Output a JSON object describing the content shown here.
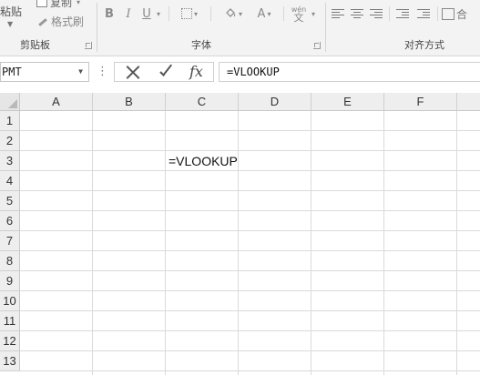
{
  "ribbon": {
    "clipboard": {
      "paste_label": "粘贴",
      "copy_label": "复制",
      "format_painter_label": "格式刷",
      "group_label": "剪贴板"
    },
    "font": {
      "bold": "B",
      "italic": "I",
      "underline": "U",
      "font_color": "A",
      "phonetic_top": "wén",
      "phonetic_bottom": "文",
      "group_label": "字体"
    },
    "alignment": {
      "group_label": "对齐方式",
      "merge_label": "合"
    }
  },
  "formula_bar": {
    "name_box": "PMT",
    "formula": "=VLOOKUP",
    "fx": "fx"
  },
  "sheet": {
    "columns": [
      "A",
      "B",
      "C",
      "D",
      "E",
      "F"
    ],
    "rows": [
      "1",
      "2",
      "3",
      "4",
      "5",
      "6",
      "7",
      "8",
      "9",
      "10",
      "11",
      "12",
      "13"
    ],
    "cell_c3": "=VLOOKUP"
  }
}
